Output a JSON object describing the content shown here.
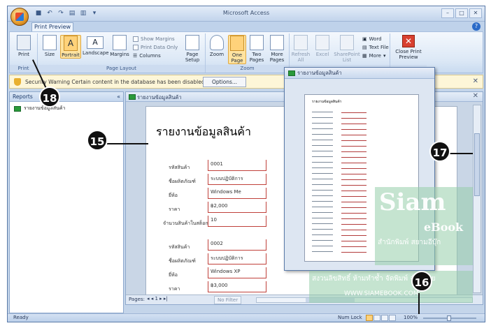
{
  "window": {
    "title": "Microsoft Access"
  },
  "tabs": {
    "active": "Print Preview"
  },
  "ribbon": {
    "print": "Print",
    "size": "Size",
    "portrait": "Portrait",
    "landscape": "Landscape",
    "margins": "Margins",
    "show_margins": "Show Margins",
    "print_data_only": "Print Data Only",
    "columns": "Columns",
    "page_setup": "Page\nSetup",
    "zoom": "Zoom",
    "one_page": "One\nPage",
    "two_pages": "Two\nPages",
    "more_pages": "More\nPages",
    "refresh_all": "Refresh\nAll",
    "excel": "Excel",
    "sharepoint_list": "SharePoint\nList",
    "word": "Word",
    "text_file": "Text File",
    "more": "More",
    "close_print_preview": "Close Print\nPreview",
    "group_print": "Print",
    "group_page_layout": "Page Layout",
    "group_zoom": "Zoom"
  },
  "security_bar": {
    "text": "Security Warning   Certain content in the database has been disabled",
    "options_button": "Options..."
  },
  "nav_pane": {
    "header": "Reports",
    "items": [
      {
        "label": "รายงานข้อมูลสินค้า"
      }
    ]
  },
  "report": {
    "tab_label": "รายงานข้อมูลสินค้า",
    "title": "รายงานข้อมูลสินค้า",
    "records": [
      {
        "fields": [
          {
            "label": "รหัสสินค้า",
            "value": "0001"
          },
          {
            "label": "ชื่อผลิตภัณฑ์",
            "value": "ระบบปฏิบัติการ"
          },
          {
            "label": "ยี่ห้อ",
            "value": "Windows Me"
          },
          {
            "label": "ราคา",
            "value": "฿2,000"
          },
          {
            "label": "จำนวนสินค้าในสต็อก",
            "value": "10"
          }
        ]
      },
      {
        "fields": [
          {
            "label": "รหัสสินค้า",
            "value": "0002"
          },
          {
            "label": "ชื่อผลิตภัณฑ์",
            "value": "ระบบปฏิบัติการ"
          },
          {
            "label": "ยี่ห้อ",
            "value": "Windows XP"
          },
          {
            "label": "ราคา",
            "value": "฿3,000"
          }
        ]
      }
    ],
    "nav": {
      "pages_label": "Pages:",
      "no_filter": "No Filter"
    }
  },
  "preview_window": {
    "title": "รายงานข้อมูลสินค้า",
    "mini_title": "รายงานข้อมูลสินค้า"
  },
  "watermark": {
    "brand": "Siam",
    "sub": "eBook",
    "thai": "สำนักพิมพ์ สยามอีบุ๊ก",
    "copyright": "สงวนลิขสิทธิ์ ห้ามทำซ้ำ จัดพิมพ์ จำหน่าย",
    "url": "WWW.SIAMEBOOK.COM"
  },
  "status_bar": {
    "ready": "Ready",
    "num_lock": "Num Lock",
    "zoom": "100%"
  },
  "callouts": {
    "c15": "15",
    "c16": "16",
    "c17": "17",
    "c18": "18"
  }
}
